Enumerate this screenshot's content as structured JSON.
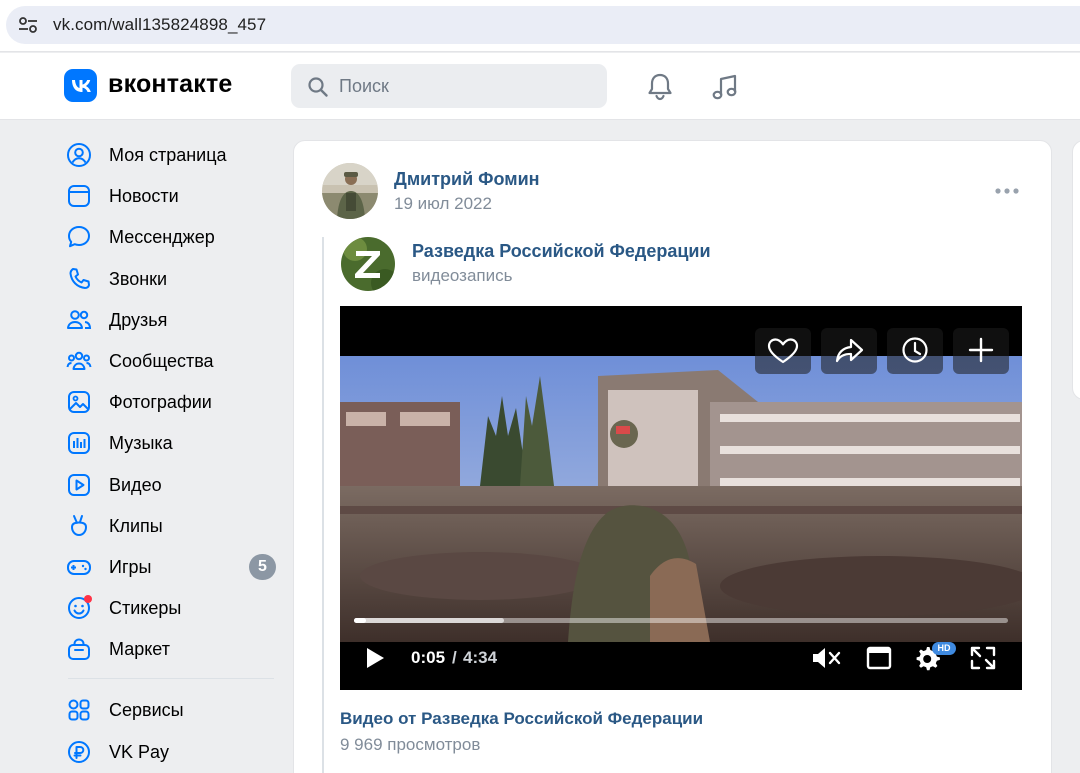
{
  "browser": {
    "url": "vk.com/wall135824898_457"
  },
  "header": {
    "logo_text": "вконтакте",
    "search_placeholder": "Поиск"
  },
  "sidebar": {
    "items": [
      {
        "label": "Моя страница",
        "icon": "user-circle-icon"
      },
      {
        "label": "Новости",
        "icon": "news-icon"
      },
      {
        "label": "Мессенджер",
        "icon": "chat-bubble-icon"
      },
      {
        "label": "Звонки",
        "icon": "phone-icon"
      },
      {
        "label": "Друзья",
        "icon": "friends-icon"
      },
      {
        "label": "Сообщества",
        "icon": "communities-icon"
      },
      {
        "label": "Фотографии",
        "icon": "photo-icon"
      },
      {
        "label": "Музыка",
        "icon": "music-icon"
      },
      {
        "label": "Видео",
        "icon": "video-icon"
      },
      {
        "label": "Клипы",
        "icon": "clips-icon"
      },
      {
        "label": "Игры",
        "icon": "gamepad-icon",
        "badge": "5"
      },
      {
        "label": "Стикеры",
        "icon": "sticker-icon",
        "has_dot": true
      },
      {
        "label": "Маркет",
        "icon": "market-bag-icon"
      }
    ],
    "secondary_items": [
      {
        "label": "Сервисы",
        "icon": "services-grid-icon"
      },
      {
        "label": "VK Pay",
        "icon": "vkpay-icon"
      }
    ]
  },
  "post": {
    "author": "Дмитрий Фомин",
    "date": "19 июл 2022",
    "repost": {
      "source_name": "Разведка Российской Федерации",
      "source_type": "видеозапись"
    },
    "video": {
      "current_time": "0:05",
      "separator": "/",
      "total_time": "4:34",
      "progress": 0.018,
      "buffered": 0.23,
      "quality_badge": "HD",
      "title": "Видео от Разведка Российской Федерации",
      "views": "9 969 просмотров"
    }
  },
  "colors": {
    "brand": "#0077ff",
    "link": "#2a5885",
    "secondary_text": "#818c99",
    "badge": "#8c97a4",
    "page_bg": "#edeef0"
  }
}
